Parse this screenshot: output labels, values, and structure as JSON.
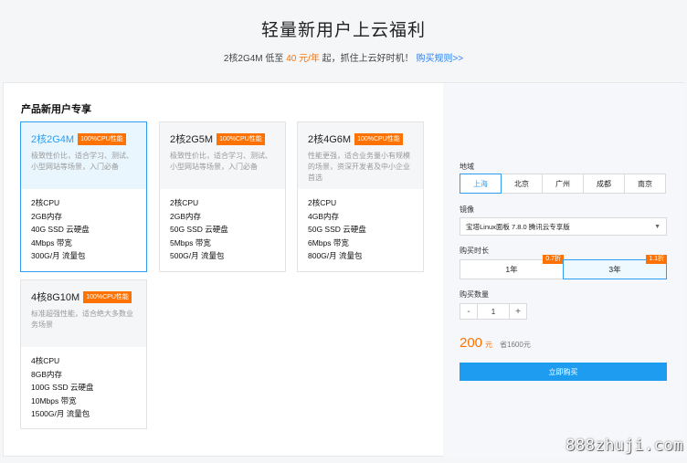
{
  "hero": {
    "title": "轻量新用户上云福利",
    "sub_prefix": "2核2G4M 低至 ",
    "sub_price": "40 元/年",
    "sub_suffix": " 起，抓住上云好时机！ ",
    "sub_link": "购买规则>>"
  },
  "products": {
    "section_title": "产品新用户专享",
    "cards": [
      {
        "name": "2核2G4M",
        "badge": "100%CPU性能",
        "desc": "极致性价比，适合学习、测试、小型网站等场景，入门必备",
        "specs": [
          "2核CPU",
          "2GB内存",
          "40G SSD 云硬盘",
          "4Mbps 带宽",
          "300G/月 流量包"
        ]
      },
      {
        "name": "2核2G5M",
        "badge": "100%CPU性能",
        "desc": "极致性价比，适合学习、测试、小型网站等场景，入门必备",
        "specs": [
          "2核CPU",
          "2GB内存",
          "50G SSD 云硬盘",
          "5Mbps 带宽",
          "500G/月 流量包"
        ]
      },
      {
        "name": "2核4G6M",
        "badge": "100%CPU性能",
        "desc": "性能更强，适合业务量小有规模的场景，资深开发者及中小企业首选",
        "specs": [
          "2核CPU",
          "4GB内存",
          "50G SSD 云硬盘",
          "6Mbps 带宽",
          "800G/月 流量包"
        ]
      },
      {
        "name": "4核8G10M",
        "badge": "100%CPU性能",
        "desc": "标准超强性能，适合绝大多数业务场景",
        "specs": [
          "4核CPU",
          "8GB内存",
          "100G SSD 云硬盘",
          "10Mbps 带宽",
          "1500G/月 流量包"
        ]
      }
    ]
  },
  "order": {
    "region_label": "地域",
    "regions": [
      "上海",
      "北京",
      "广州",
      "成都",
      "南京"
    ],
    "image_label": "镜像",
    "image_value": "宝塔Linux面板 7.8.0 腾讯云专享版",
    "duration_label": "购买时长",
    "durations": [
      {
        "label": "1年",
        "discount": "0.7折"
      },
      {
        "label": "3年",
        "discount": "1.1折"
      }
    ],
    "quantity_label": "购买数量",
    "quantity": "1",
    "minus": "-",
    "plus": "+",
    "price": "200",
    "price_unit": "元",
    "saving": "省1600元",
    "buy_button": "立即购买"
  },
  "watermark": "888zhuji.com",
  "colors": {
    "accent_orange": "#ff7200",
    "accent_blue": "#2e9df0",
    "button_blue": "#1e9cf0"
  },
  "selected": {
    "card_index": 0,
    "region_index": 0,
    "duration_index": 1
  }
}
